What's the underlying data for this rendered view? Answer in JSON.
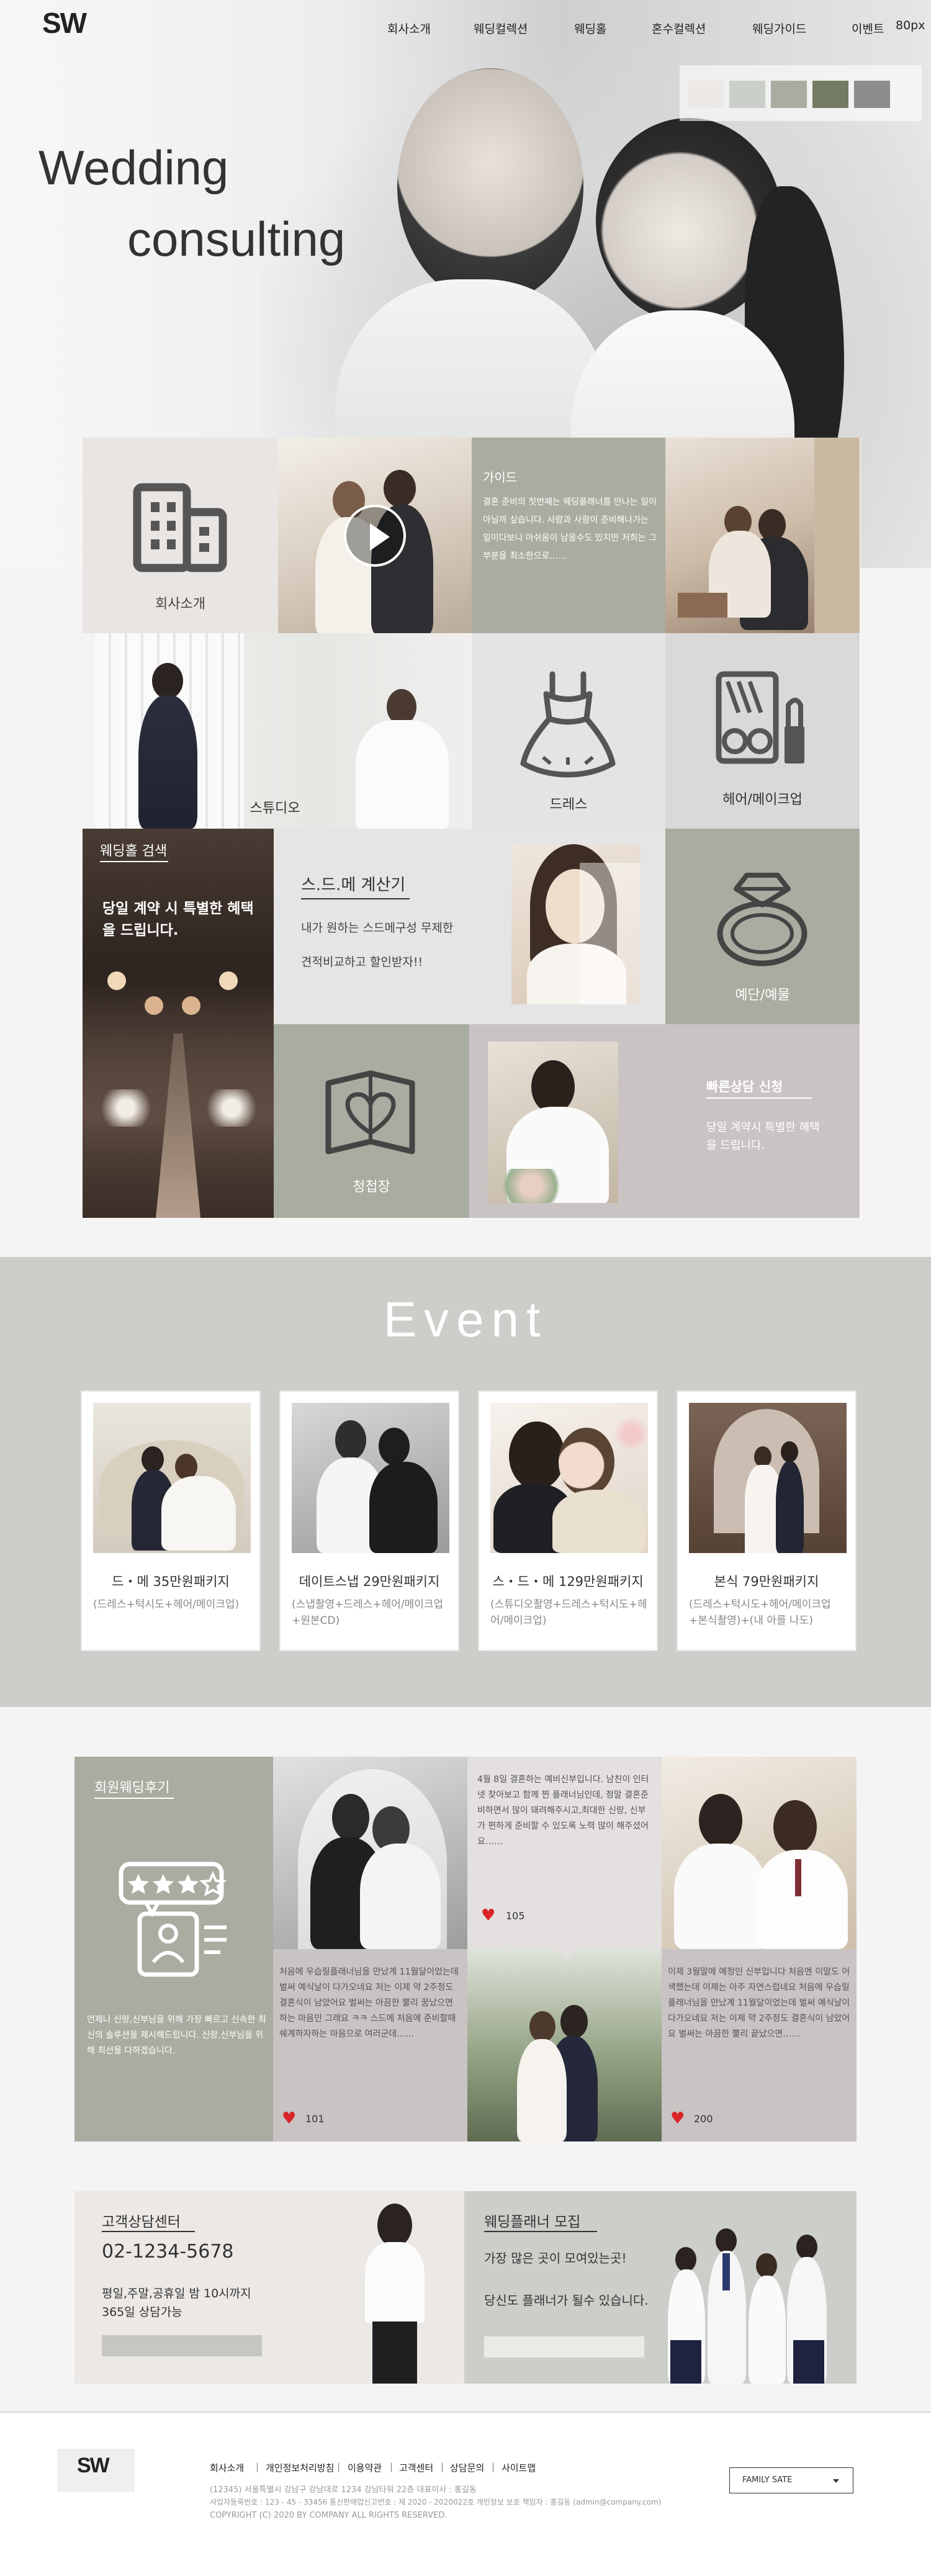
{
  "header": {
    "logo": "SW",
    "nav": [
      "회사소개",
      "웨딩컬렉션",
      "웨딩홀",
      "혼수컬렉션",
      "웨딩가이드",
      "이벤트"
    ],
    "note": "80px"
  },
  "hero": {
    "title_line1": "Wedding",
    "title_line2": "consulting",
    "swatches": [
      "#ece8e6",
      "#cbcfc9",
      "#a9aca0",
      "#737b64",
      "#8c8c8c"
    ]
  },
  "grid": {
    "company": "회사소개",
    "guide_title": "가이드",
    "guide_text": "결혼 준비의 첫번째는 웨딩플래너를 만나는 일이 아닐까 싶습니다. 사람과 사람이 준비해나가는 일이다보니 아쉬움이 남을수도 있지만 저희는 그부분을 최소한으로……",
    "studio": "스튜디오",
    "dress": "드레스",
    "hair_makeup": "헤어/메이크업",
    "hall_title": "웨딩홀 검색",
    "hall_text": "당일 계약 시 특별한 혜택을 드립니다.",
    "sdm_title": "스.드.메 계산기",
    "sdm_text1": "내가 원하는 스드메구성 무제한",
    "sdm_text2": "견적비교하고 할인받자!!",
    "ring": "예단/예물",
    "invitation": "청첩장",
    "quick_title": "빠른상담 신청",
    "quick_text": "당일 계약시 특별한 혜택을 드립니다."
  },
  "event": {
    "title": "Event",
    "cards": [
      {
        "title": "드・메 35만원패키지",
        "desc": "(드레스+턱시도+헤어/메이크업)"
      },
      {
        "title": "데이트스냅 29만원패키지",
        "desc": "(스냅촬영+드레스+헤어/메이크업+원본CD)"
      },
      {
        "title": "스・드・메 129만원패키지",
        "desc": "(스튜디오촬영+드레스+턱시도+헤어/메이크업)"
      },
      {
        "title": "본식 79만원패키지",
        "desc": "(드레스+턱시도+헤어/메이크업+본식촬영)+(내 아를 나도)"
      }
    ]
  },
  "reviews": {
    "title": "회원웨딩후기",
    "intro": "언제나 신랑,신부님을 위해 가장 빠르고 신속한 최신의 솔루션을 제시해드립니다. 신랑,신부님을 위해 최선을 다하겠습니다.",
    "items": [
      {
        "text": "처음에 우습릴플래너님을 만났계 11월달이었는데 벌써 예식날이 다가오네요 저는 이제 약 2주정도 결혼식이 남았어요 벌써는 아끔한 뿔리 꿈났으면 하는 마음인 그래요 ㅋㅋ 스드메 처음에 준비할때 쉐계하자하는 마음으로 여러군데……",
        "likes": "101"
      },
      {
        "text": "4월 8일 결혼하는 예비신부입니다. 남친이 인터넷 찾아보고 함께 찐 플래너님인데, 정말 결혼준비하면서 많이 돼려해주시고,최대한 신랑, 신부가 편하게 준비할 수 있도록 노력 많이 해주셨어요……",
        "likes": "105"
      },
      {
        "text": "이제 3월말에 예정인 신부입니다 처음엔 이말도 어색했는데 이제는 아주 자연스럽네요 처음에 우습릴플래너님을 만났계 11월달이었는데 벌써 예식날이 다가오네요 저는 이제 약 2주정도 결혼식이 남았어요 벌써는 아끔한 뿔리 끝났으면……",
        "likes": "200"
      }
    ]
  },
  "contact": {
    "title": "고객상담센터",
    "phone": "02-1234-5678",
    "hours1": "평일,주말,공휴일 밤 10시까지",
    "hours2": "365일 상담가능",
    "recruit_title": "웨딩플래너 모집",
    "recruit_text1": "가장 많은 곳이 모여있는곳!",
    "recruit_text2": "당신도 플래너가 될수 있습니다."
  },
  "footer": {
    "logo": "SW",
    "links": [
      "회사소개",
      "개인정보처리방침",
      "이용약관",
      "고객센터",
      "상담문의",
      "사이트맵"
    ],
    "address": "(12345) 서울특별시 강남구 강남대로 1234 강남타워 22층 대표이사 : 홍길동",
    "license": "사업자등록번호 : 123 - 45 - 33456 통신판매업신고번호 : 제 2020 - 2020022호 개인정보 보호 책임자 : 홍길동 (admin@company.com)",
    "copyright": "COPYRIGHT (C) 2020 BY COMPANY ALL RIGHTS RESERVED.",
    "family_site": "FAMILY SATE"
  }
}
